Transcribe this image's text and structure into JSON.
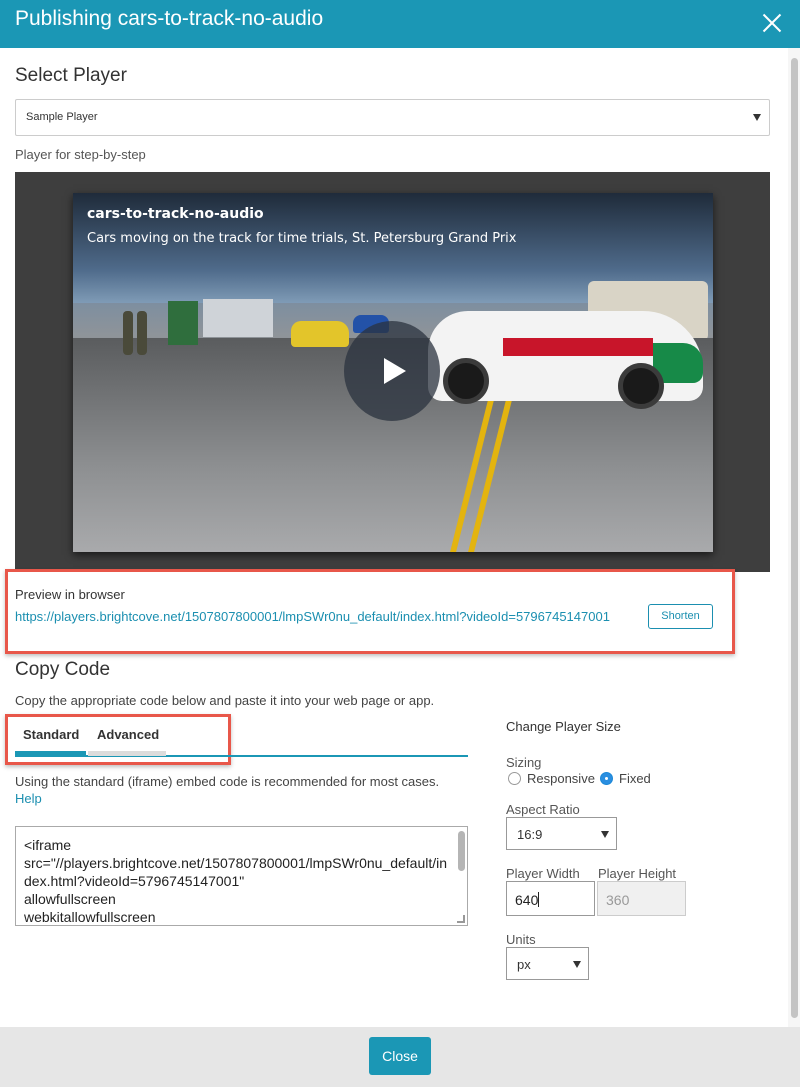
{
  "dialog": {
    "title": "Publishing cars-to-track-no-audio"
  },
  "select_player": {
    "heading": "Select Player",
    "selected": "Sample Player",
    "player_caption": "Player for step-by-step"
  },
  "video": {
    "title": "cars-to-track-no-audio",
    "description": "Cars moving on the track for time trials, St. Petersburg Grand Prix"
  },
  "preview": {
    "label": "Preview in browser",
    "url": "https://players.brightcove.net/1507807800001/lmpSWr0nu_default/index.html?videoId=5796745147001",
    "shorten_label": "Shorten"
  },
  "copy_code": {
    "heading": "Copy Code",
    "description": "Copy the appropriate code below and paste it into your web page or app.",
    "tabs": [
      {
        "label": "Standard",
        "active": true
      },
      {
        "label": "Advanced",
        "active": false
      }
    ],
    "standard_note": "Using the standard (iframe) embed code is recommended for most cases.",
    "help_label": "Help",
    "code": "<iframe\nsrc=\"//players.brightcove.net/1507807800001/lmpSWr0nu_default/index.html?videoId=5796745147001\"\nallowfullscreen\nwebkitallowfullscreen\nmozallowfullscreen></iframe>"
  },
  "player_size": {
    "heading": "Change Player Size",
    "sizing_label": "Sizing",
    "sizing_options": [
      {
        "label": "Responsive",
        "checked": false
      },
      {
        "label": "Fixed",
        "checked": true
      }
    ],
    "aspect_ratio_label": "Aspect Ratio",
    "aspect_ratio_value": "16:9",
    "width_label": "Player Width",
    "width_value": "640",
    "height_label": "Player Height",
    "height_value": "360",
    "units_label": "Units",
    "units_value": "px"
  },
  "footer": {
    "close_label": "Close"
  },
  "colors": {
    "accent": "#1b97b5",
    "link": "#1b8fb0",
    "highlight": "#e8574a",
    "tab_active_underline": "#1b97b5",
    "tab_inactive_underline": "#dcdcdc"
  }
}
